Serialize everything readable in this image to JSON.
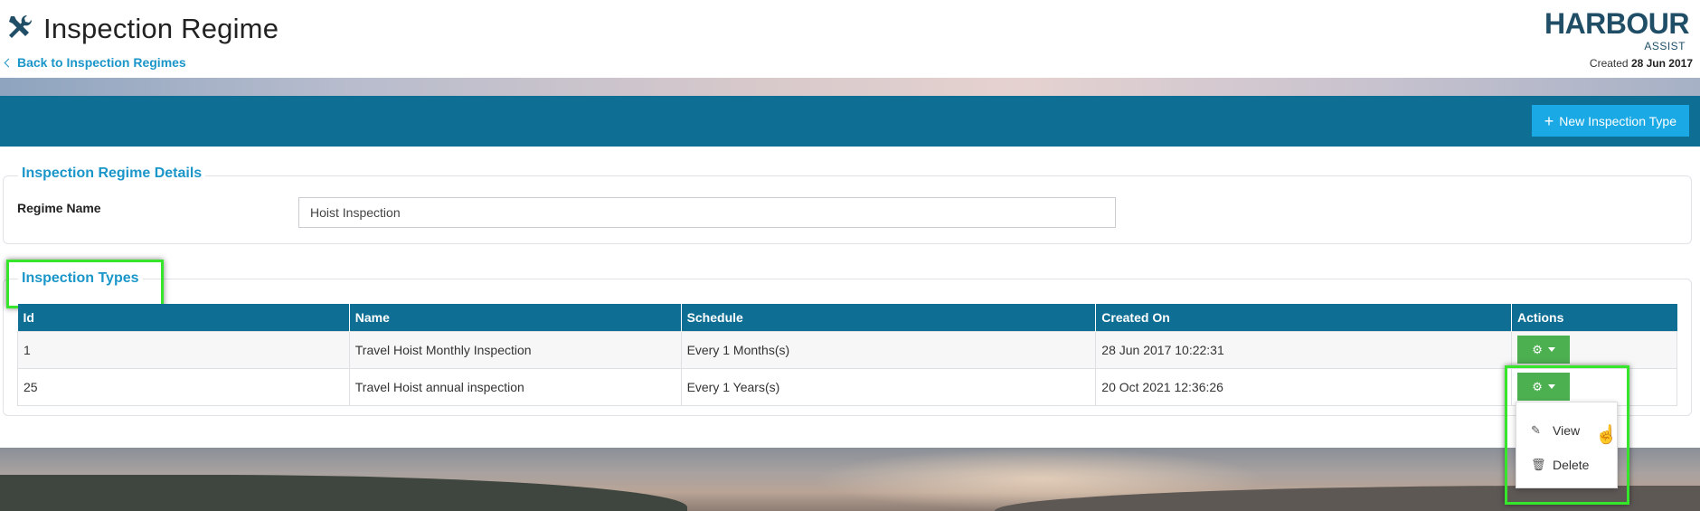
{
  "header": {
    "title": "Inspection Regime",
    "back_link": "Back to Inspection Regimes",
    "logo_main": "HARBOUR",
    "logo_sub": "ASSIST",
    "created_label": "Created",
    "created_date": "28 Jun 2017"
  },
  "toolbar": {
    "new_button": "New Inspection Type"
  },
  "details": {
    "legend": "Inspection Regime Details",
    "regime_label": "Regime Name",
    "regime_value": "Hoist Inspection"
  },
  "types": {
    "legend": "Inspection Types",
    "columns": [
      "Id",
      "Name",
      "Schedule",
      "Created On",
      "Actions"
    ],
    "rows": [
      {
        "id": "1",
        "name": "Travel Hoist Monthly Inspection",
        "schedule": "Every 1 Months(s)",
        "created_on": "28 Jun 2017 10:22:31"
      },
      {
        "id": "25",
        "name": "Travel Hoist annual inspection",
        "schedule": "Every 1 Years(s)",
        "created_on": "20 Oct 2021 12:36:26"
      }
    ]
  },
  "dropdown": {
    "items": [
      "View",
      "Delete"
    ]
  },
  "colors": {
    "accent": "#0f6e93",
    "link": "#1a96c9",
    "action_button": "#4caf50",
    "highlight": "#35e62a"
  }
}
